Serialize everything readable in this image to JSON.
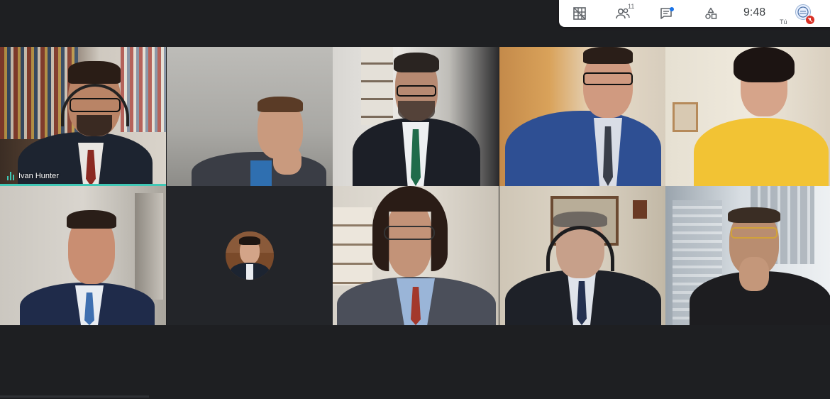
{
  "toolbar": {
    "icons": [
      "grid-view-icon",
      "people-icon",
      "chat-icon",
      "activities-icon"
    ],
    "participant_count": "11",
    "clock": "9:48",
    "self_label": "Tú"
  },
  "participants": [
    {
      "name": "Ivan Hunter",
      "speaking": true
    },
    {
      "name": ""
    },
    {
      "name": ""
    },
    {
      "name": ""
    },
    {
      "name": ""
    },
    {
      "name": ""
    },
    {
      "name": ""
    },
    {
      "name": ""
    },
    {
      "name": ""
    },
    {
      "name": ""
    }
  ],
  "colors": {
    "background": "#1e1f22",
    "speaking_accent": "#40c7b5",
    "mic_off": "#d93025",
    "chat_dot": "#1a73e8"
  }
}
